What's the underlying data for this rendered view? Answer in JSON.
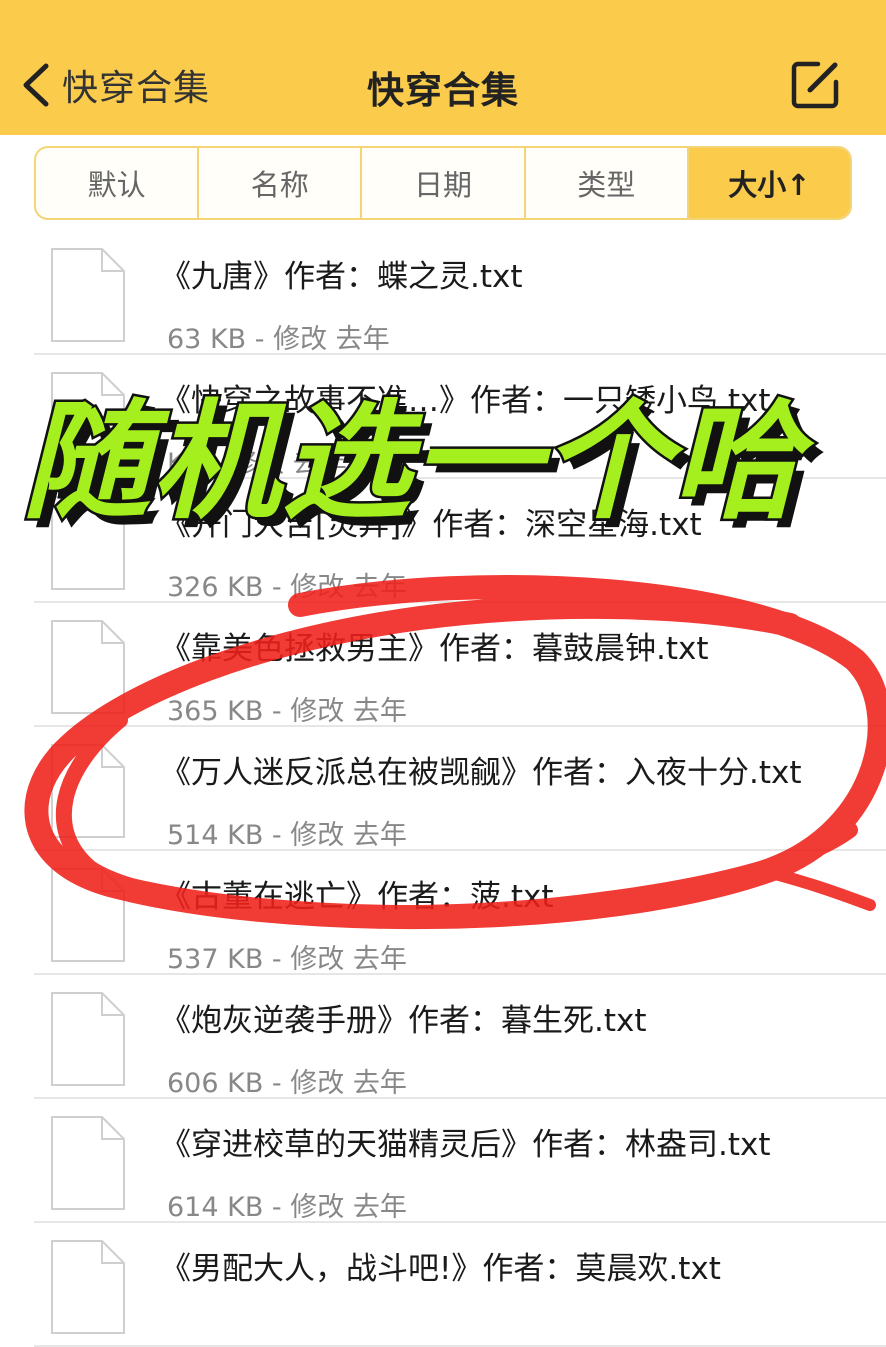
{
  "header": {
    "back_label": "快穿合集",
    "title": "快穿合集",
    "edit_icon": "compose-icon"
  },
  "sort_tabs": [
    {
      "label": "默认",
      "active": false
    },
    {
      "label": "名称",
      "active": false
    },
    {
      "label": "日期",
      "active": false
    },
    {
      "label": "类型",
      "active": false
    },
    {
      "label": "大小↑",
      "active": true
    }
  ],
  "files": [
    {
      "name": "《九唐》作者：蝶之灵.txt",
      "meta": "63 KB - 修改 去年"
    },
    {
      "name": "《快穿之故事不准…》作者：一只矮小鸟.txt",
      "meta": "KB - 修改 去年"
    },
    {
      "name": "《开门大吉[灵异]》作者：深空星海.txt",
      "meta": "326 KB - 修改 去年"
    },
    {
      "name": "《靠美色拯救男主》作者：暮鼓晨钟.txt",
      "meta": "365 KB - 修改 去年"
    },
    {
      "name": "《万人迷反派总在被觊觎》作者：入夜十分.txt",
      "meta": "514 KB - 修改 去年"
    },
    {
      "name": "《古董在逃亡》作者：菠.txt",
      "meta": "537 KB - 修改 去年"
    },
    {
      "name": "《炮灰逆袭手册》作者：暮生死.txt",
      "meta": "606 KB - 修改 去年"
    },
    {
      "name": "《穿进校草的天猫精灵后》作者：林盎司.txt",
      "meta": "614 KB - 修改 去年"
    },
    {
      "name": "《男配大人，战斗吧!》作者：莫晨欢.txt",
      "meta": ""
    }
  ],
  "overlay": {
    "caption": "随机选一个哈",
    "caption_color": "#a6ef1e",
    "highlight_color": "#f0201a"
  }
}
